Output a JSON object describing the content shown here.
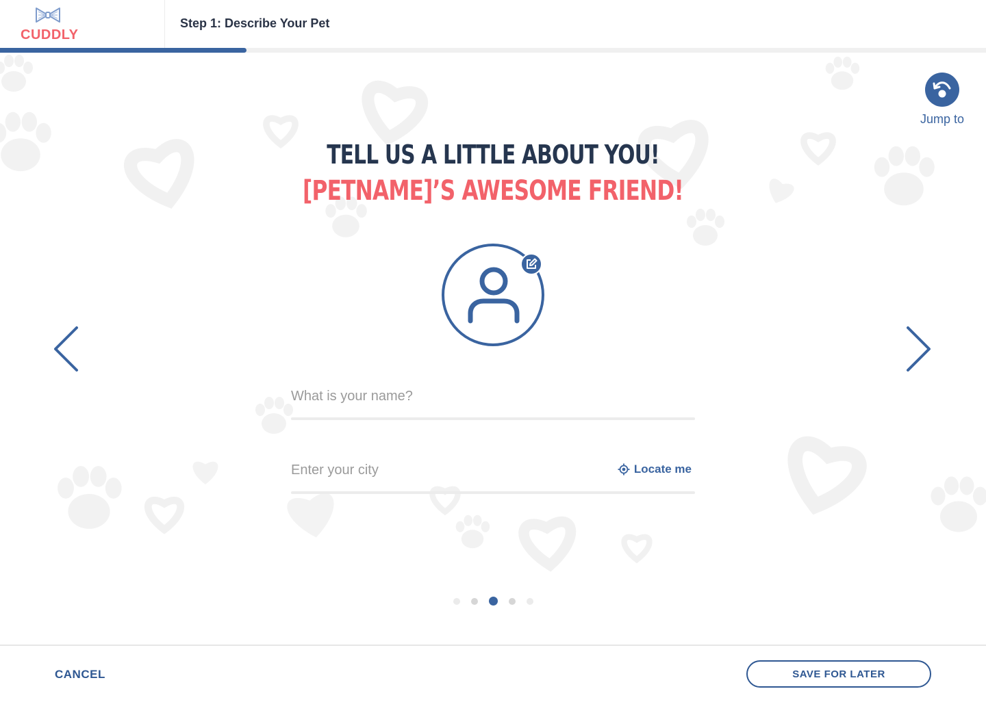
{
  "app": {
    "logo_text": "CUDDLY",
    "logo_icon": "bow-tie-icon",
    "brand_color": "#f2626a",
    "accent_color": "#3a64a0"
  },
  "header": {
    "step_title": "Step 1: Describe Your Pet",
    "progress_fraction": 0.25
  },
  "jump": {
    "label": "Jump to",
    "icon": "jump-arrow-icon"
  },
  "heading": {
    "line1": "TELL US A LITTLE ABOUT YOU!",
    "line2": "[PETNAME]’S AWESOME FRIEND!"
  },
  "avatar": {
    "icon": "user-avatar-icon",
    "edit_icon": "edit-icon"
  },
  "form": {
    "name": {
      "placeholder": "What is your name?",
      "value": ""
    },
    "city": {
      "placeholder": "Enter your city",
      "value": "",
      "locate_label": "Locate me",
      "locate_icon": "crosshair-icon"
    }
  },
  "pagination": {
    "total": 5,
    "current_index": 2
  },
  "footer": {
    "cancel_label": "CANCEL",
    "save_label": "SAVE FOR LATER"
  }
}
